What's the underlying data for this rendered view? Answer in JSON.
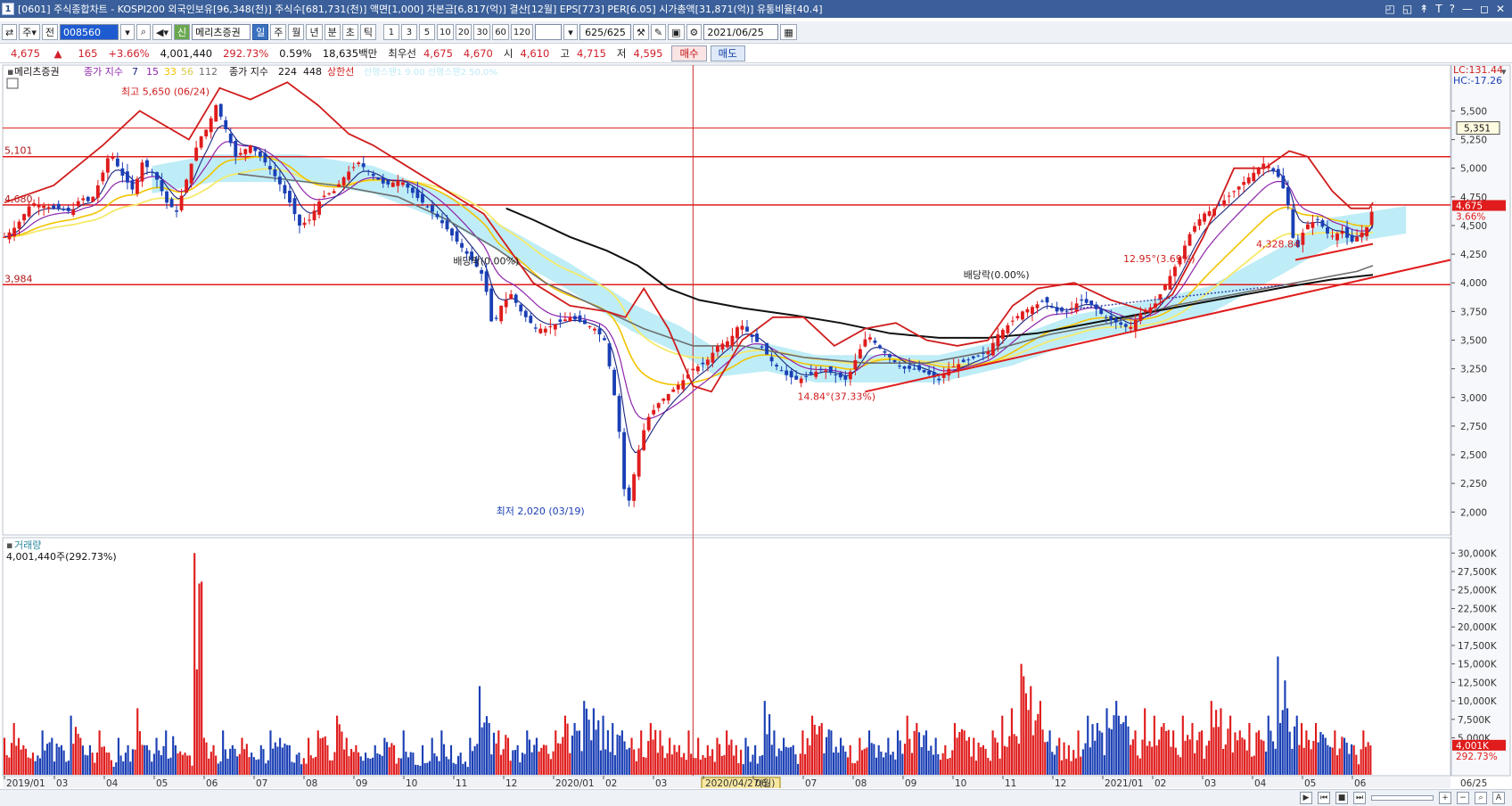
{
  "window": {
    "number": "1",
    "title": "[0601] 주식종합차트 - KOSPI200 외국인보유[96,348(천)] 주식수[681,731(천)] 액면[1,000] 자본금[6,817(억)] 결산[12월] EPS[773] PER[6.05] 시가총액[31,871(억)] 유통비율[40.4]",
    "controls": [
      "◰",
      "◱",
      "↟",
      "T",
      "?",
      "—",
      "◻",
      "✕"
    ]
  },
  "toolbar": {
    "type_select": "주",
    "scope_button": "전",
    "code": "008560",
    "new_badge": "신",
    "stock_name": "메리츠증권",
    "periods": [
      "일",
      "주",
      "월",
      "년",
      "분",
      "초",
      "틱"
    ],
    "active_period": "일",
    "intervals": [
      "1",
      "3",
      "5",
      "10",
      "20",
      "30",
      "60",
      "120"
    ],
    "count": "625/625",
    "date": "2021/06/25"
  },
  "quote": {
    "price": "4,675",
    "arrow": "▲",
    "change": "165",
    "change_pct": "+3.66%",
    "volume": "4,001,440",
    "volume_ratio": "292.73%",
    "turnover": "0.59%",
    "amount": "18,635백만",
    "best_ask_label": "최우선",
    "best_ask": "4,675",
    "best_bid": "4,670",
    "open_label": "시",
    "open": "4,610",
    "high_label": "고",
    "high": "4,715",
    "low_label": "저",
    "low": "4,595",
    "buy_label": "매수",
    "sell_label": "매도"
  },
  "legend": {
    "name": "메리츠증권",
    "ma_label": "종가 지수",
    "ma_short": [
      "7",
      "15",
      "33",
      "56",
      "112"
    ],
    "ma_long_label": "종가 지수",
    "ma_long": [
      "224",
      "448"
    ],
    "envelope_label": "상한선",
    "faded_text": "선행스팬1 9.00  선행스팬2 50.0%"
  },
  "colors": {
    "up": "#e01c1c",
    "down": "#1a3fb5",
    "ma7": "#1a237e",
    "ma15": "#8e24aa",
    "ma33": "#f2c300",
    "ma56": "#f5e96a",
    "ma112": "#6e6e6e",
    "ma224": "#111111",
    "envelope": "#d01d1d",
    "cloud": "#aee8f5",
    "hline": "#e01c1c",
    "trend": "#e01c1c",
    "vline": "#c62828"
  },
  "chart_data": {
    "type": "candlestick",
    "x_ticks": [
      "2019/01",
      "03",
      "04",
      "05",
      "06",
      "07",
      "08",
      "09",
      "10",
      "11",
      "12",
      "2020/01",
      "02",
      "03",
      "2020/04/27(월)",
      "06",
      "07",
      "08",
      "09",
      "10",
      "11",
      "12",
      "2021/01",
      "02",
      "03",
      "04",
      "05",
      "06"
    ],
    "x_end_label": "06/25",
    "price_axis": {
      "ticks": [
        "5,500",
        "5,250",
        "5,000",
        "4,750",
        "4,500",
        "4,250",
        "4,000",
        "3,750",
        "3,500",
        "3,250",
        "3,000",
        "2,750",
        "2,500",
        "2,250",
        "2,000"
      ],
      "lc_label": "LC:131.44",
      "hc_label": "HC:-17.26",
      "current_price_tag": "4,675",
      "current_pct_tag": "3.66%",
      "cross_price_tag": "5,351"
    },
    "volume_panel": {
      "title": "거래량",
      "info": "4,001,440주(292.73%)",
      "ticks": [
        "30,000K",
        "27,500K",
        "25,000K",
        "22,500K",
        "20,000K",
        "17,500K",
        "15,000K",
        "12,500K",
        "10,000K",
        "7,500K",
        "5,000K"
      ],
      "current_tag": "4,001K",
      "current_pct": "292.73%"
    },
    "horizontal_lines": [
      {
        "value": 5101,
        "label": "5,101"
      },
      {
        "value": 4680,
        "label": "4,680"
      },
      {
        "value": 3984,
        "label": "3,984"
      }
    ],
    "annotations": {
      "high": "최고 5,650 (06/24)",
      "low": "최저 2,020 (03/19)",
      "dividend_1": "배당락(0.00%)",
      "dividend_2": "배당락(0.00%)",
      "trend_1": "14.84°(37.33%)",
      "trend_2": "12.95°(3.69%)",
      "support": "4,328.84"
    },
    "close_path": [
      [
        0,
        4400
      ],
      [
        10,
        4500
      ],
      [
        22,
        4700
      ],
      [
        40,
        4650
      ],
      [
        55,
        4620
      ],
      [
        62,
        4750
      ],
      [
        70,
        4700
      ],
      [
        78,
        4900
      ],
      [
        86,
        5150
      ],
      [
        95,
        4950
      ],
      [
        105,
        4800
      ],
      [
        112,
        5050
      ],
      [
        122,
        4950
      ],
      [
        132,
        4700
      ],
      [
        140,
        4620
      ],
      [
        148,
        4900
      ],
      [
        158,
        5250
      ],
      [
        165,
        5350
      ],
      [
        172,
        5550
      ],
      [
        178,
        5400
      ],
      [
        188,
        5100
      ],
      [
        200,
        5200
      ],
      [
        212,
        5050
      ],
      [
        222,
        4900
      ],
      [
        232,
        4700
      ],
      [
        240,
        4500
      ],
      [
        248,
        4550
      ],
      [
        258,
        4750
      ],
      [
        268,
        4800
      ],
      [
        278,
        4950
      ],
      [
        288,
        5050
      ],
      [
        298,
        4950
      ],
      [
        310,
        4850
      ],
      [
        322,
        4900
      ],
      [
        335,
        4750
      ],
      [
        350,
        4600
      ],
      [
        365,
        4400
      ],
      [
        380,
        4200
      ],
      [
        390,
        4050
      ],
      [
        397,
        3600
      ],
      [
        404,
        3800
      ],
      [
        412,
        3900
      ],
      [
        420,
        3750
      ],
      [
        432,
        3600
      ],
      [
        440,
        3600
      ],
      [
        450,
        3650
      ],
      [
        460,
        3700
      ],
      [
        470,
        3650
      ],
      [
        480,
        3600
      ],
      [
        488,
        3500
      ],
      [
        495,
        3100
      ],
      [
        500,
        2700
      ],
      [
        504,
        2200
      ],
      [
        508,
        2100
      ],
      [
        515,
        2500
      ],
      [
        522,
        2800
      ],
      [
        532,
        2950
      ],
      [
        542,
        3050
      ],
      [
        552,
        3150
      ],
      [
        560,
        3250
      ],
      [
        570,
        3300
      ],
      [
        580,
        3450
      ],
      [
        590,
        3500
      ],
      [
        598,
        3650
      ],
      [
        606,
        3550
      ],
      [
        615,
        3450
      ],
      [
        625,
        3300
      ],
      [
        635,
        3200
      ],
      [
        645,
        3150
      ],
      [
        655,
        3200
      ],
      [
        665,
        3250
      ],
      [
        675,
        3200
      ],
      [
        685,
        3150
      ],
      [
        695,
        3400
      ],
      [
        702,
        3550
      ],
      [
        710,
        3450
      ],
      [
        720,
        3350
      ],
      [
        730,
        3250
      ],
      [
        742,
        3250
      ],
      [
        752,
        3200
      ],
      [
        760,
        3150
      ],
      [
        768,
        3250
      ],
      [
        778,
        3300
      ],
      [
        790,
        3350
      ],
      [
        800,
        3400
      ],
      [
        808,
        3550
      ],
      [
        818,
        3650
      ],
      [
        828,
        3750
      ],
      [
        838,
        3800
      ],
      [
        846,
        3850
      ],
      [
        855,
        3750
      ],
      [
        865,
        3750
      ],
      [
        875,
        3850
      ],
      [
        885,
        3800
      ],
      [
        895,
        3700
      ],
      [
        905,
        3650
      ],
      [
        915,
        3600
      ],
      [
        925,
        3750
      ],
      [
        935,
        3800
      ],
      [
        945,
        4000
      ],
      [
        955,
        4200
      ],
      [
        965,
        4450
      ],
      [
        975,
        4600
      ],
      [
        985,
        4650
      ],
      [
        995,
        4750
      ],
      [
        1005,
        4850
      ],
      [
        1015,
        4950
      ],
      [
        1025,
        5050
      ],
      [
        1035,
        4950
      ],
      [
        1043,
        4750
      ],
      [
        1050,
        4250
      ],
      [
        1058,
        4500
      ],
      [
        1068,
        4550
      ],
      [
        1078,
        4400
      ],
      [
        1088,
        4450
      ],
      [
        1095,
        4350
      ],
      [
        1100,
        4400
      ],
      [
        1105,
        4450
      ],
      [
        1110,
        4510
      ],
      [
        1113,
        4675
      ]
    ],
    "ma112_path": [
      [
        190,
        4950
      ],
      [
        230,
        4900
      ],
      [
        270,
        4850
      ],
      [
        320,
        4750
      ],
      [
        360,
        4550
      ],
      [
        400,
        4300
      ],
      [
        440,
        4000
      ],
      [
        480,
        3800
      ],
      [
        520,
        3600
      ],
      [
        560,
        3450
      ],
      [
        600,
        3450
      ],
      [
        650,
        3350
      ],
      [
        700,
        3300
      ],
      [
        750,
        3300
      ],
      [
        800,
        3400
      ],
      [
        850,
        3550
      ],
      [
        900,
        3650
      ],
      [
        950,
        3800
      ],
      [
        1000,
        3900
      ],
      [
        1050,
        4000
      ],
      [
        1100,
        4100
      ],
      [
        1113,
        4150
      ]
    ],
    "ma224_path": [
      [
        408,
        4650
      ],
      [
        430,
        4550
      ],
      [
        460,
        4400
      ],
      [
        490,
        4280
      ],
      [
        515,
        4150
      ],
      [
        540,
        3950
      ],
      [
        565,
        3850
      ],
      [
        600,
        3780
      ],
      [
        640,
        3720
      ],
      [
        680,
        3650
      ],
      [
        720,
        3560
      ],
      [
        760,
        3520
      ],
      [
        800,
        3520
      ],
      [
        840,
        3560
      ],
      [
        880,
        3640
      ],
      [
        920,
        3720
      ],
      [
        960,
        3800
      ],
      [
        1000,
        3880
      ],
      [
        1040,
        3960
      ],
      [
        1080,
        4030
      ],
      [
        1113,
        4070
      ]
    ],
    "envelope_path": [
      [
        0,
        4700
      ],
      [
        40,
        4850
      ],
      [
        80,
        5200
      ],
      [
        110,
        5500
      ],
      [
        150,
        5250
      ],
      [
        175,
        5700
      ],
      [
        200,
        5600
      ],
      [
        230,
        5750
      ],
      [
        255,
        5550
      ],
      [
        280,
        5300
      ],
      [
        300,
        5200
      ],
      [
        330,
        5000
      ],
      [
        360,
        4800
      ],
      [
        390,
        4600
      ],
      [
        410,
        4300
      ],
      [
        430,
        4000
      ],
      [
        460,
        3800
      ],
      [
        490,
        3750
      ],
      [
        505,
        3700
      ],
      [
        520,
        3950
      ],
      [
        540,
        3600
      ],
      [
        560,
        3100
      ],
      [
        575,
        3050
      ],
      [
        600,
        3500
      ],
      [
        625,
        3700
      ],
      [
        650,
        3700
      ],
      [
        675,
        3450
      ],
      [
        700,
        3600
      ],
      [
        725,
        3650
      ],
      [
        750,
        3500
      ],
      [
        775,
        3450
      ],
      [
        800,
        3500
      ],
      [
        820,
        3800
      ],
      [
        840,
        3950
      ],
      [
        870,
        4000
      ],
      [
        900,
        3850
      ],
      [
        930,
        3750
      ],
      [
        950,
        3900
      ],
      [
        975,
        4400
      ],
      [
        1000,
        5000
      ],
      [
        1025,
        5000
      ],
      [
        1045,
        5150
      ],
      [
        1060,
        5100
      ],
      [
        1080,
        4800
      ],
      [
        1095,
        4650
      ],
      [
        1110,
        4650
      ],
      [
        1113,
        4700
      ]
    ],
    "cloud_path": [
      [
        120,
        4900
      ],
      [
        170,
        5000
      ],
      [
        240,
        5000
      ],
      [
        300,
        4900
      ],
      [
        360,
        4650
      ],
      [
        410,
        4350
      ],
      [
        460,
        4050
      ],
      [
        510,
        3700
      ],
      [
        550,
        3500
      ],
      [
        580,
        3300
      ],
      [
        620,
        3350
      ],
      [
        660,
        3250
      ],
      [
        700,
        3250
      ],
      [
        760,
        3250
      ],
      [
        820,
        3400
      ],
      [
        870,
        3600
      ],
      [
        920,
        3700
      ],
      [
        980,
        3850
      ],
      [
        1040,
        4200
      ],
      [
        1080,
        4450
      ],
      [
        1140,
        4550
      ]
    ],
    "volumes_k": [
      5,
      7,
      4,
      3,
      6,
      5,
      4,
      8,
      5,
      4,
      6,
      3,
      5,
      4,
      9,
      4,
      5,
      6,
      4,
      3,
      30,
      5,
      4,
      6,
      4,
      5,
      3,
      4,
      6,
      5,
      4,
      3,
      5,
      6,
      4,
      8,
      5,
      4,
      3,
      4,
      5,
      4,
      6,
      3,
      4,
      5,
      6,
      4,
      3,
      5,
      12,
      7,
      6,
      5,
      4,
      6,
      5,
      4,
      6,
      8,
      7,
      10,
      9,
      8,
      7,
      6,
      5,
      6,
      7,
      6,
      5,
      4,
      6,
      5,
      4,
      5,
      6,
      4,
      5,
      4,
      10,
      6,
      5,
      4,
      6,
      8,
      7,
      6,
      5,
      4,
      5,
      6,
      4,
      5,
      6,
      8,
      7,
      6,
      5,
      4,
      7,
      6,
      5,
      4,
      6,
      8,
      9,
      15,
      12,
      10,
      6,
      5,
      4,
      6,
      8,
      7,
      9,
      10,
      8,
      6,
      9,
      8,
      7,
      6,
      8,
      7,
      6,
      10,
      9,
      8,
      6,
      7,
      6,
      8,
      16,
      9,
      8,
      6,
      7,
      5,
      6,
      5,
      4,
      6
    ]
  }
}
